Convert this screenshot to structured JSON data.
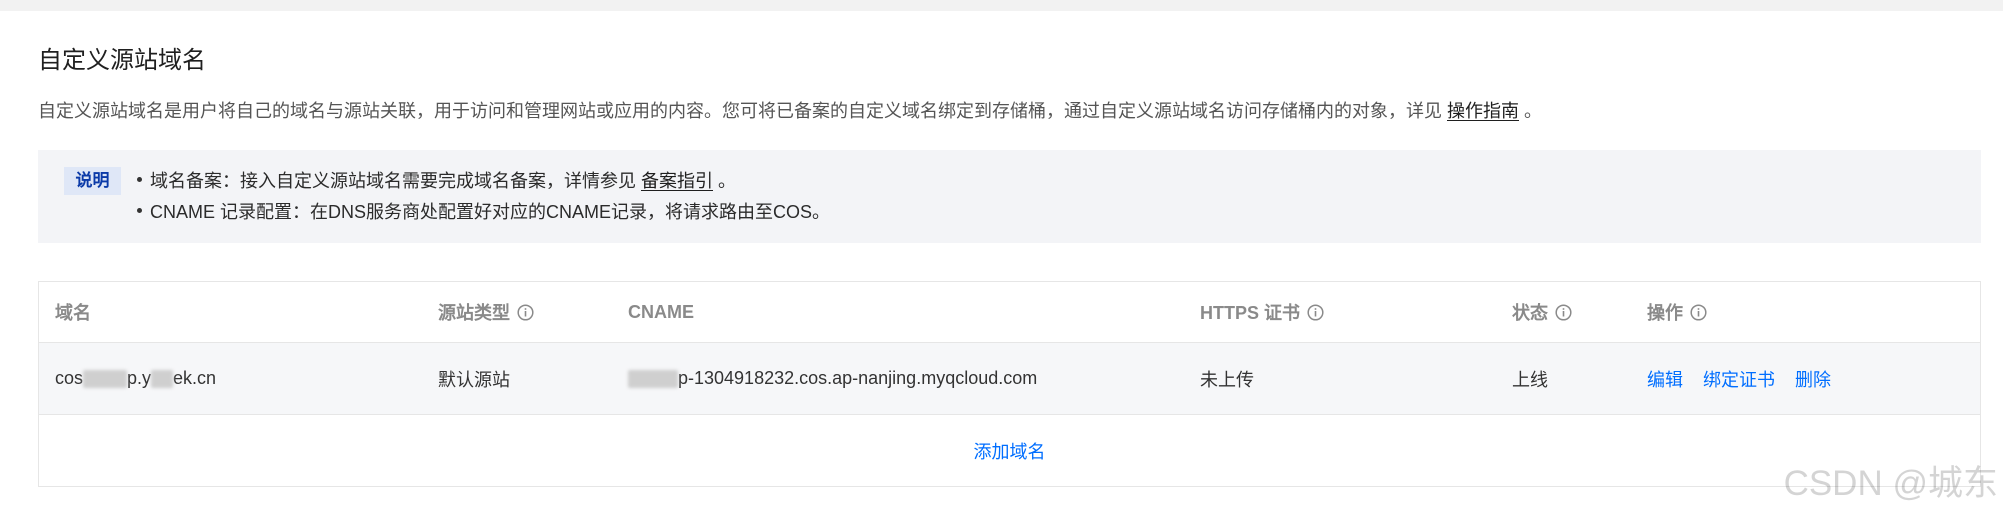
{
  "page": {
    "title": "自定义源站域名",
    "description_prefix": "自定义源站域名是用户将自己的域名与源站关联，用于访问和管理网站或应用的内容。您可将已备案的自定义域名绑定到存储桶，通过自定义源站域名访问存储桶内的对象，详见 ",
    "description_link": "操作指南",
    "description_suffix": " 。"
  },
  "notice": {
    "badge": "说明",
    "items": [
      {
        "prefix": "域名备案：接入自定义源站域名需要完成域名备案，详情参见 ",
        "link": "备案指引",
        "suffix": " 。"
      },
      {
        "text": "CNAME 记录配置：在DNS服务商处配置好对应的CNAME记录，将请求路由至COS。"
      }
    ]
  },
  "table": {
    "columns": [
      {
        "label": "域名",
        "icon": null
      },
      {
        "label": "源站类型",
        "icon": "info-icon"
      },
      {
        "label": "CNAME",
        "icon": null
      },
      {
        "label": "HTTPS 证书",
        "icon": "info-icon"
      },
      {
        "label": "状态",
        "icon": "info-icon"
      },
      {
        "label": "操作",
        "icon": "info-icon"
      }
    ],
    "rows": [
      {
        "domain_parts": [
          "cos",
          "p.y",
          "ek.cn"
        ],
        "origin_type": "默认源站",
        "cname": "p-1304918232.cos.ap-nanjing.myqcloud.com",
        "https_cert": "未上传",
        "status": "上线",
        "actions": [
          "编辑",
          "绑定证书",
          "删除"
        ]
      }
    ],
    "add_label": "添加域名"
  },
  "watermark": "CSDN @城东",
  "colors": {
    "link": "#006eff",
    "notice_bg": "#f3f4f7",
    "badge_text": "#0b3aa8",
    "border": "#e6e6e6"
  }
}
